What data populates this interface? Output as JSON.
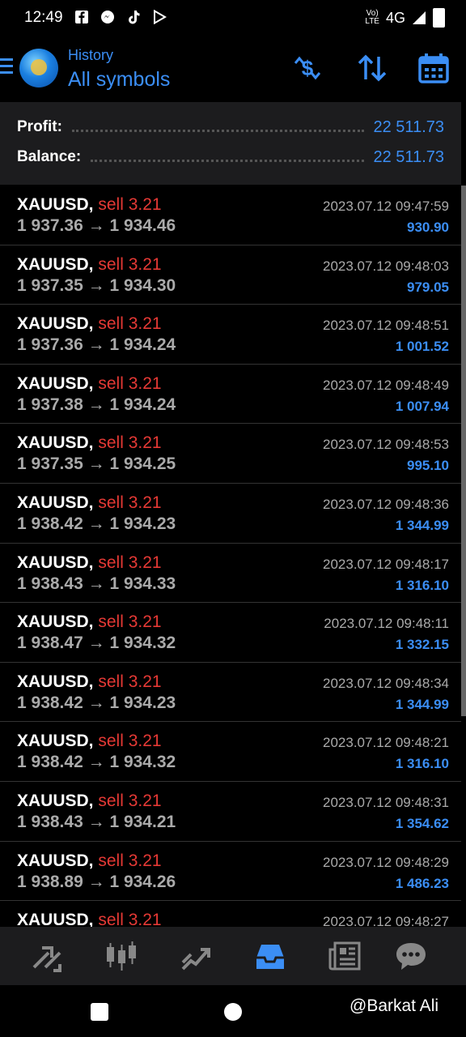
{
  "status": {
    "time": "12:49",
    "network": "4G"
  },
  "header": {
    "subtitle": "History",
    "title": "All symbols"
  },
  "summary": {
    "profit_label": "Profit:",
    "profit_value": "22 511.73",
    "balance_label": "Balance:",
    "balance_value": "22 511.73"
  },
  "trades": [
    {
      "symbol": "XAUUSD,",
      "side": "sell 3.21",
      "open": "1 937.36",
      "close": "1 934.46",
      "time": "2023.07.12 09:47:59",
      "profit": "930.90"
    },
    {
      "symbol": "XAUUSD,",
      "side": "sell 3.21",
      "open": "1 937.35",
      "close": "1 934.30",
      "time": "2023.07.12 09:48:03",
      "profit": "979.05"
    },
    {
      "symbol": "XAUUSD,",
      "side": "sell 3.21",
      "open": "1 937.36",
      "close": "1 934.24",
      "time": "2023.07.12 09:48:51",
      "profit": "1 001.52"
    },
    {
      "symbol": "XAUUSD,",
      "side": "sell 3.21",
      "open": "1 937.38",
      "close": "1 934.24",
      "time": "2023.07.12 09:48:49",
      "profit": "1 007.94"
    },
    {
      "symbol": "XAUUSD,",
      "side": "sell 3.21",
      "open": "1 937.35",
      "close": "1 934.25",
      "time": "2023.07.12 09:48:53",
      "profit": "995.10"
    },
    {
      "symbol": "XAUUSD,",
      "side": "sell 3.21",
      "open": "1 938.42",
      "close": "1 934.23",
      "time": "2023.07.12 09:48:36",
      "profit": "1 344.99"
    },
    {
      "symbol": "XAUUSD,",
      "side": "sell 3.21",
      "open": "1 938.43",
      "close": "1 934.33",
      "time": "2023.07.12 09:48:17",
      "profit": "1 316.10"
    },
    {
      "symbol": "XAUUSD,",
      "side": "sell 3.21",
      "open": "1 938.47",
      "close": "1 934.32",
      "time": "2023.07.12 09:48:11",
      "profit": "1 332.15"
    },
    {
      "symbol": "XAUUSD,",
      "side": "sell 3.21",
      "open": "1 938.42",
      "close": "1 934.23",
      "time": "2023.07.12 09:48:34",
      "profit": "1 344.99"
    },
    {
      "symbol": "XAUUSD,",
      "side": "sell 3.21",
      "open": "1 938.42",
      "close": "1 934.32",
      "time": "2023.07.12 09:48:21",
      "profit": "1 316.10"
    },
    {
      "symbol": "XAUUSD,",
      "side": "sell 3.21",
      "open": "1 938.43",
      "close": "1 934.21",
      "time": "2023.07.12 09:48:31",
      "profit": "1 354.62"
    },
    {
      "symbol": "XAUUSD,",
      "side": "sell 3.21",
      "open": "1 938.89",
      "close": "1 934.26",
      "time": "2023.07.12 09:48:29",
      "profit": "1 486.23"
    },
    {
      "symbol": "XAUUSD,",
      "side": "sell 3.21",
      "open": "",
      "close": "",
      "time": "2023.07.12 09:48:27",
      "profit": ""
    }
  ],
  "arrow": "→",
  "bottom_nav": [
    "quotes-icon",
    "chart-icon",
    "trade-icon",
    "history-icon",
    "news-icon",
    "messages-icon"
  ],
  "colors": {
    "accent": "#3b8ef5",
    "sell": "#e53935",
    "muted": "#aaaaaa"
  },
  "watermark": "@Barkat Ali"
}
